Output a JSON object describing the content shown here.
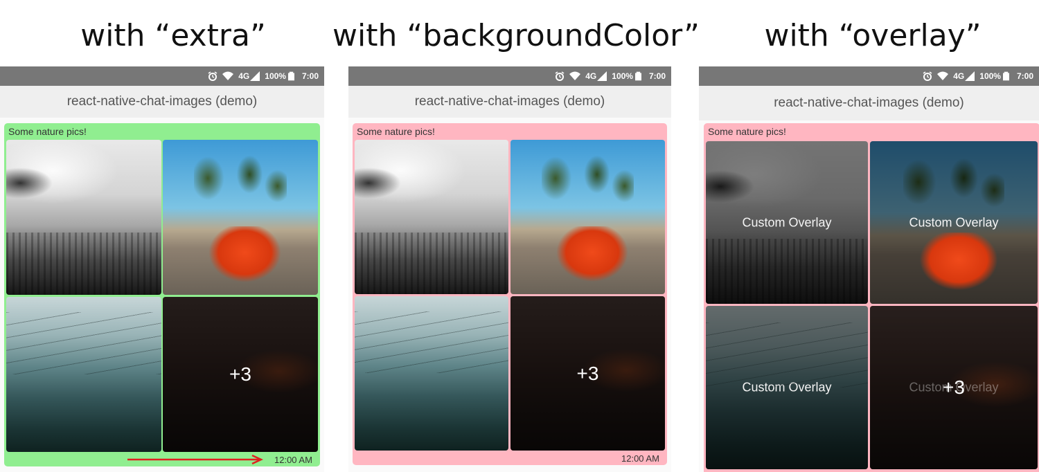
{
  "panels": [
    {
      "heading": "with “extra”",
      "status": {
        "network": "4G",
        "battery": "100%",
        "time": "7:00"
      },
      "app_title": "react-native-chat-images (demo)",
      "bubble_color": "#90ee90",
      "message_text": "Some nature pics!",
      "more_count": "+3",
      "timestamp": "12:00 AM"
    },
    {
      "heading": "with “backgroundColor”",
      "status": {
        "network": "4G",
        "battery": "100%",
        "time": "7:00"
      },
      "app_title": "react-native-chat-images (demo)",
      "bubble_color": "#ffb6c1",
      "message_text": "Some nature pics!",
      "more_count": "+3",
      "timestamp": "12:00 AM"
    },
    {
      "heading": "with “overlay”",
      "status": {
        "network": "4G",
        "battery": "100%",
        "time": "7:00"
      },
      "app_title": "react-native-chat-images (demo)",
      "bubble_color": "#ffb6c1",
      "message_text": "Some nature pics!",
      "overlay_label": "Custom Overlay",
      "more_count": "+3"
    }
  ],
  "icons": [
    "alarm-icon",
    "wifi-icon",
    "signal-icon",
    "battery-icon",
    "arrow-icon"
  ],
  "colors": {
    "status_bar": "#777777",
    "app_bar": "#efefef",
    "arrow": "#e02020"
  }
}
